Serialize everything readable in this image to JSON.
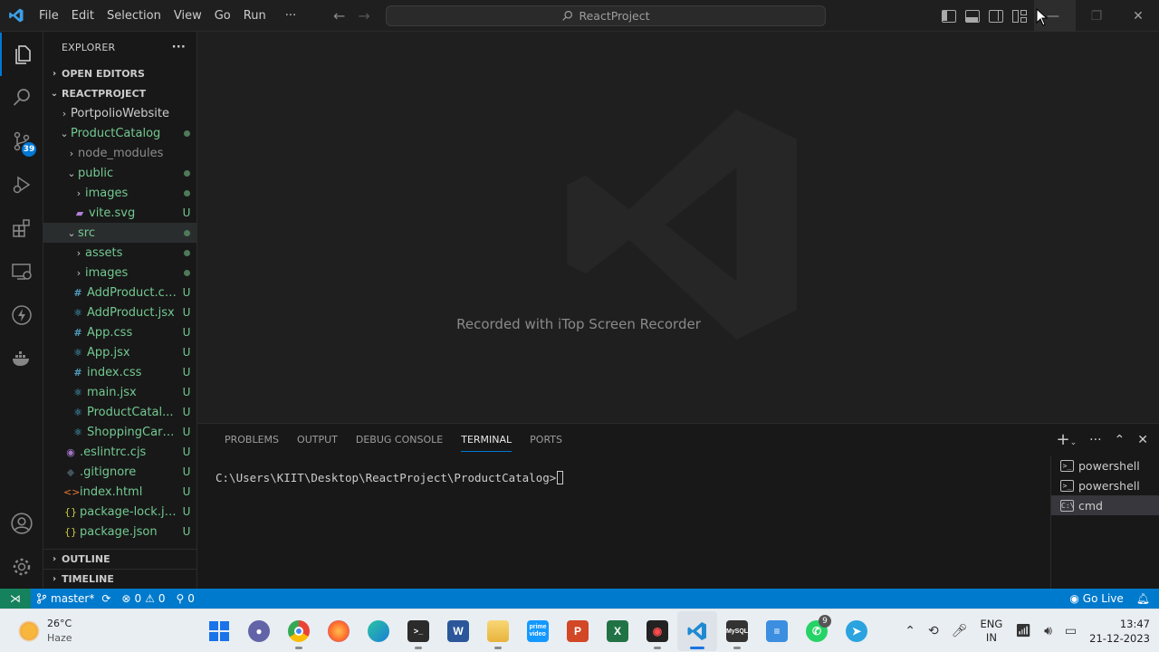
{
  "titlebar": {
    "menu": [
      "File",
      "Edit",
      "Selection",
      "View",
      "Go",
      "Run",
      "···"
    ],
    "search": "ReactProject"
  },
  "activity": {
    "source_control_badge": "39"
  },
  "explorer": {
    "title": "EXPLORER",
    "more": "···",
    "open_editors": "OPEN EDITORS",
    "root": "REACTPROJECT",
    "items": [
      {
        "name": "PortpolioWebsite",
        "status": ""
      },
      {
        "name": "ProductCatalog",
        "status": ""
      },
      {
        "name": "node_modules",
        "status": ""
      },
      {
        "name": "public",
        "status": ""
      },
      {
        "name": "images",
        "status": ""
      },
      {
        "name": "vite.svg",
        "status": "U"
      },
      {
        "name": "src",
        "status": ""
      },
      {
        "name": "assets",
        "status": ""
      },
      {
        "name": "images",
        "status": ""
      },
      {
        "name": "AddProduct.css",
        "status": "U"
      },
      {
        "name": "AddProduct.jsx",
        "status": "U"
      },
      {
        "name": "App.css",
        "status": "U"
      },
      {
        "name": "App.jsx",
        "status": "U"
      },
      {
        "name": "index.css",
        "status": "U"
      },
      {
        "name": "main.jsx",
        "status": "U"
      },
      {
        "name": "ProductCatal...",
        "status": "U"
      },
      {
        "name": "ShoppingCart...",
        "status": "U"
      },
      {
        "name": ".eslintrc.cjs",
        "status": "U"
      },
      {
        "name": ".gitignore",
        "status": "U"
      },
      {
        "name": "index.html",
        "status": "U"
      },
      {
        "name": "package-lock.js...",
        "status": "U"
      },
      {
        "name": "package.json",
        "status": "U"
      }
    ],
    "outline": "OUTLINE",
    "timeline": "TIMELINE"
  },
  "editor": {
    "watermark": "Recorded with iTop Screen Recorder"
  },
  "panel": {
    "tabs": [
      "PROBLEMS",
      "OUTPUT",
      "DEBUG CONSOLE",
      "TERMINAL",
      "PORTS"
    ],
    "active_tab": "TERMINAL",
    "prompt": "C:\\Users\\KIIT\\Desktop\\ReactProject\\ProductCatalog>",
    "terminals": [
      "powershell",
      "powershell",
      "cmd"
    ]
  },
  "statusbar": {
    "branch": "master*",
    "errors": "0",
    "warnings": "0",
    "ports": "0",
    "go_live": "Go Live"
  },
  "taskbar": {
    "temperature": "26°C",
    "weather": "Haze",
    "lang_top": "ENG",
    "lang_bottom": "IN",
    "time": "13:47",
    "date": "21-12-2023",
    "whatsapp_badge": "9"
  },
  "colors": {
    "accent": "#0078d4",
    "statusbar": "#007acc",
    "untracked": "#73c991"
  }
}
